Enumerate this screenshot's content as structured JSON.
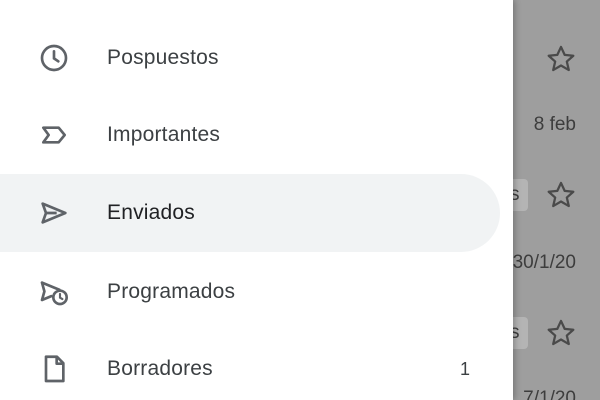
{
  "background_list": {
    "dates": [
      "8 feb",
      "30/1/20",
      "7/1/20"
    ],
    "chip_letter": "s"
  },
  "drawer": {
    "items": [
      {
        "label": "Pospuestos",
        "icon": "clock-icon",
        "count": ""
      },
      {
        "label": "Importantes",
        "icon": "label-important-icon",
        "count": ""
      },
      {
        "label": "Enviados",
        "icon": "send-icon",
        "count": "",
        "active": true
      },
      {
        "label": "Programados",
        "icon": "schedule-send-icon",
        "count": ""
      },
      {
        "label": "Borradores",
        "icon": "draft-file-icon",
        "count": "1"
      }
    ]
  },
  "colors": {
    "active_bg": "#f1f3f4",
    "scrim": "#9e9e9e",
    "icon": "#5f6368",
    "text": "#3c4043"
  }
}
